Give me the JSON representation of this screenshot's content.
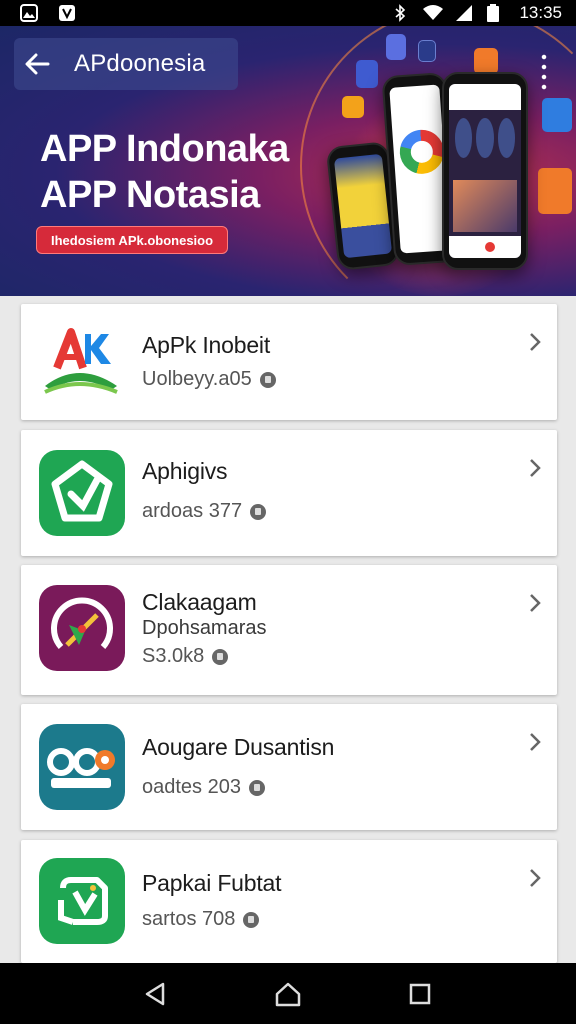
{
  "status_bar": {
    "time": "13:35",
    "left_icons": [
      "gallery-icon",
      "app-notification-icon"
    ],
    "right_icons": [
      "bluetooth-icon",
      "wifi-icon",
      "signal-icon",
      "battery-icon"
    ]
  },
  "header": {
    "title": "APdoonesia",
    "hero_line1": "APP Indonaka",
    "hero_line2": "APP Notasia",
    "hero_pill": "Ihedosiem APk.obonesioo"
  },
  "apps": [
    {
      "name": "ApPk Inobeit",
      "sub": "",
      "meta": "Uolbeyy.a05",
      "icon": "apk-logo-icon"
    },
    {
      "name": "Aphigivs",
      "sub": "",
      "meta": "ardoas 377",
      "icon": "green-shield-icon"
    },
    {
      "name": "Clakaagam",
      "sub": "Dpohsamaras",
      "meta": "S3.0k8",
      "icon": "purple-compass-icon"
    },
    {
      "name": "Aougare Dusantisn",
      "sub": "",
      "meta": "oadtes 203",
      "icon": "teal-owl-icon"
    },
    {
      "name": "Papkai Fubtat",
      "sub": "",
      "meta": "sartos 708",
      "icon": "green-refresh-icon"
    }
  ],
  "colors": {
    "banner_dark": "#1c2766",
    "pill_red": "#d62a3a",
    "green": "#1fa653",
    "purple": "#7a1a5a",
    "teal": "#1c7a8c"
  }
}
